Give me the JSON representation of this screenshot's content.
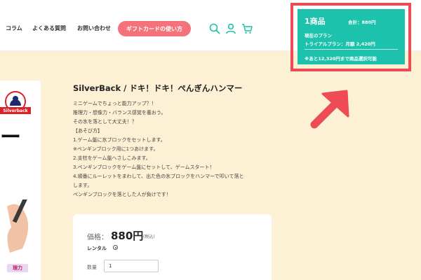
{
  "header": {
    "nav": [
      "コラム",
      "よくある質問",
      "お問い合わせ"
    ],
    "gift_button": "ギフトカードの使い方",
    "icons": [
      "search-icon",
      "user-icon",
      "cart-icon"
    ],
    "accent_color": "#1cc2ac"
  },
  "product_image": {
    "brand_label": "Silverback",
    "big_text": "ー",
    "tag": "理力"
  },
  "product": {
    "title": "SilverBack / ドキ！ドキ！ぺんぎんハンマー",
    "description": [
      "ミニゲームでちょっと能力アップ？！",
      "推理力・想像力・バランス感覚を養おう。",
      "その氷を落として大丈夫！？",
      "【あそび方】",
      "1.ゲーム盤に氷ブロックをセットします。",
      "※ペンギンブロック用に1つあけます。",
      "2.支柱をゲーム盤へさしこみます。",
      "3.ペンギンブロックをゲーム盤にセットして、ゲームスタート！",
      "4.順番にルーレットをまわして、出た色の氷ブロックをハンマーで叩いて落と",
      "します。",
      "ペンギンブロックを落とした人が負けです！"
    ]
  },
  "purchase": {
    "price_label": "価格：",
    "price": "880円",
    "tax": "(税込)",
    "rental_label": "レンタル",
    "qty_label": "数量",
    "qty_value": "1"
  },
  "cart": {
    "count": "1商品",
    "total": "合計：880円",
    "plan_label": "現在のプラン",
    "plan_value": "トライアルプラン：月額 2,420円",
    "note": "※あと12,320円まで商品選択可能",
    "highlight_color": "#ee4b55"
  }
}
